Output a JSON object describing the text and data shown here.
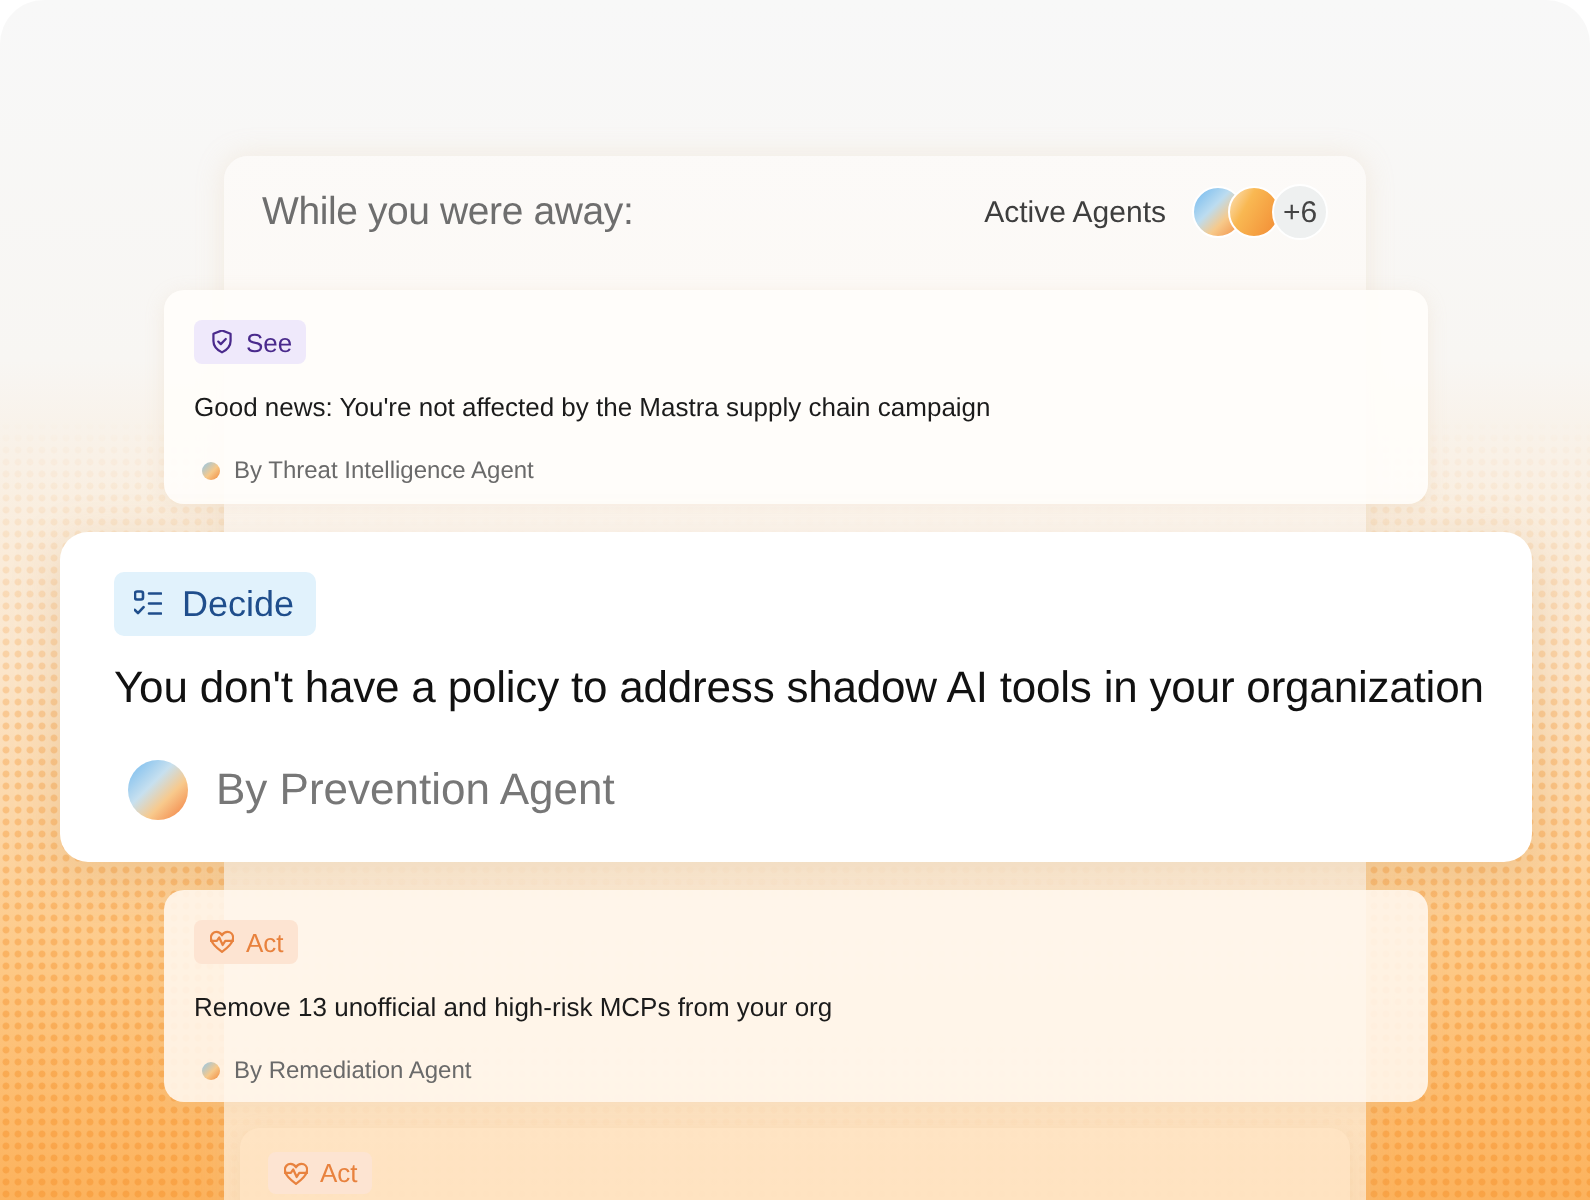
{
  "header": {
    "title": "While you were away:",
    "active_agents": {
      "label": "Active Agents",
      "more": "+6"
    }
  },
  "cards": [
    {
      "kind": "see",
      "tag": "See",
      "title": "Good news: You're not affected by the Mastra supply chain campaign",
      "agent": "By Threat Intelligence Agent",
      "selected": false
    },
    {
      "kind": "decide",
      "tag": "Decide",
      "title": "You don't have a policy to address shadow AI tools in your organization",
      "agent": "By Prevention Agent",
      "selected": true
    },
    {
      "kind": "act",
      "tag": "Act",
      "title": "Remove 13 unofficial and high-risk MCPs from your org",
      "agent": "By Remediation Agent",
      "selected": false
    },
    {
      "kind": "act",
      "tag": "Act",
      "selected": false
    }
  ]
}
